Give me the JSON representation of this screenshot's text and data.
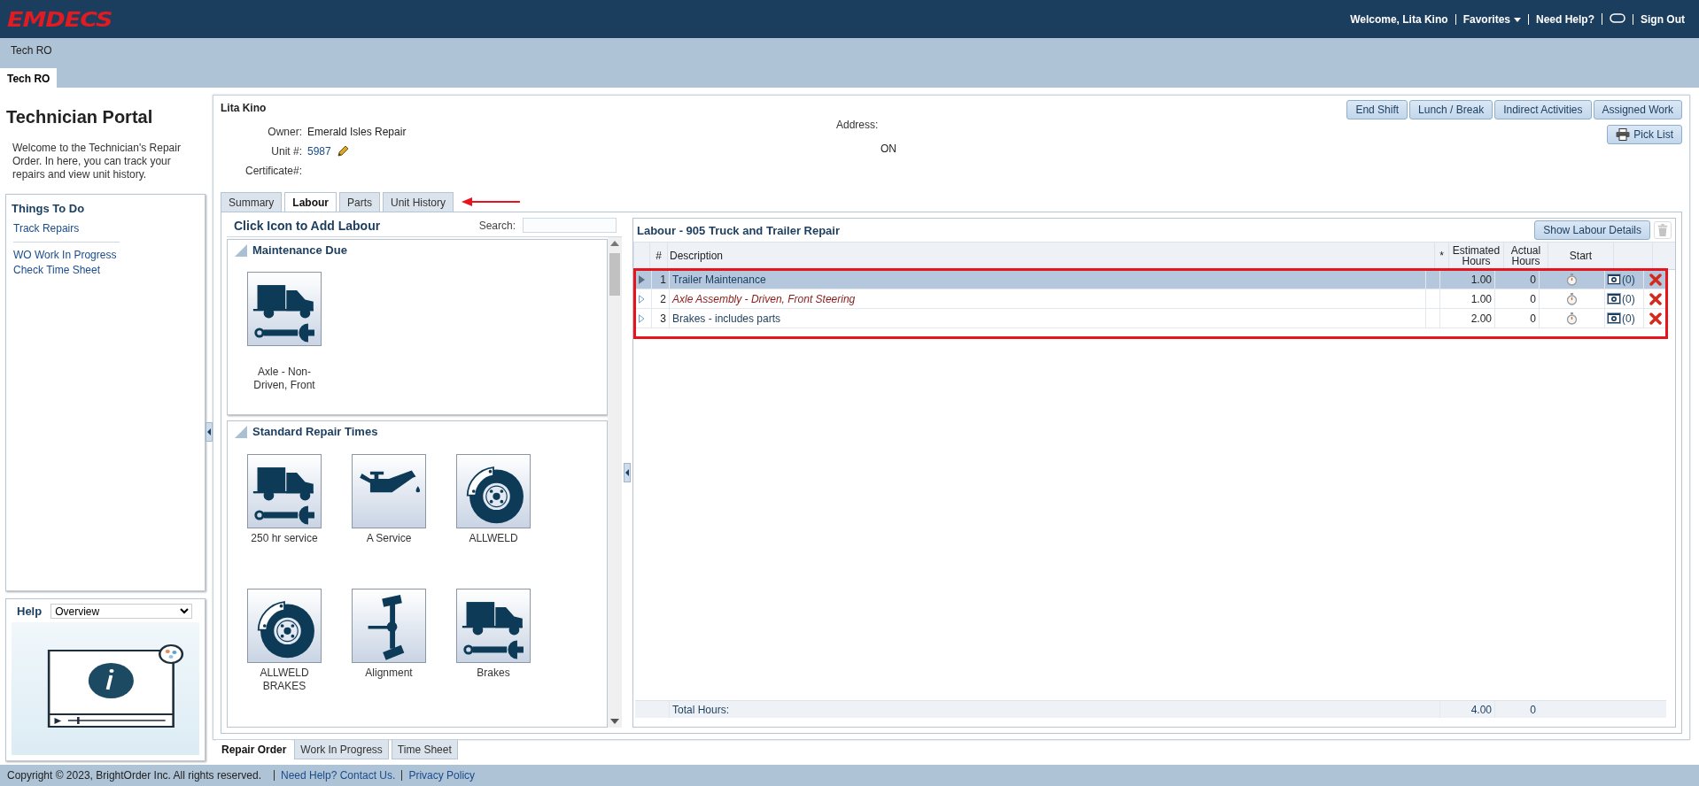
{
  "app": {
    "logo": "EMDECS",
    "welcome": "Welcome, Lita Kino",
    "links": [
      {
        "label": "Favorites",
        "dropdown": true
      },
      {
        "label": "Need Help?",
        "dropdown": false
      }
    ],
    "sign_out": "Sign Out"
  },
  "breadcrumb": "Tech RO",
  "page_tabs": [
    {
      "label": "Tech RO",
      "selected": true
    }
  ],
  "sidebar": {
    "title": "Technician Portal",
    "intro": "Welcome to the Technician's Repair Order. In here, you can track your repairs and view unit history.",
    "things_to_do": {
      "title": "Things To Do",
      "groups": [
        {
          "links": [
            "Track Repairs"
          ]
        },
        {
          "links": [
            "WO Work In Progress",
            "Check Time Sheet"
          ]
        }
      ]
    },
    "help": {
      "title": "Help",
      "topic": "Overview"
    }
  },
  "repair_order": {
    "technician": "Lita Kino",
    "fields": [
      {
        "label": "Owner:",
        "value": "Emerald Isles Repair",
        "kind": "text"
      },
      {
        "label": "Unit #:",
        "value": "5987",
        "kind": "link"
      },
      {
        "label": "Certificate#:"
      }
    ],
    "address": {
      "label": "Address:",
      "value": "ON"
    },
    "actions": [
      "End Shift",
      "Lunch / Break",
      "Indirect Activities",
      "Assigned Work"
    ],
    "pick_list": "Pick List",
    "tabs": [
      {
        "label": "Summary",
        "selected": false
      },
      {
        "label": "Labour",
        "selected": true
      },
      {
        "label": "Parts",
        "selected": false
      },
      {
        "label": "Unit History",
        "selected": false
      }
    ]
  },
  "labour_picker": {
    "title": "Click Icon to Add Labour",
    "search_label": "Search:",
    "sections": [
      {
        "title": "Maintenance Due",
        "expanded": true,
        "tiles": [
          {
            "label": "Axle - Non-Driven, Front",
            "kind": "truck"
          }
        ]
      },
      {
        "title": "Standard Repair Times",
        "expanded": true,
        "tiles": [
          {
            "label": "250 hr service",
            "kind": "truck"
          },
          {
            "label": "A Service",
            "kind": "oil"
          },
          {
            "label": "ALLWELD",
            "kind": "brake"
          },
          {
            "label": "ALLWELD BRAKES",
            "kind": "brake"
          },
          {
            "label": "Alignment",
            "kind": "alignment"
          },
          {
            "label": "Brakes",
            "kind": "truck"
          }
        ]
      }
    ]
  },
  "labour": {
    "title": "Labour - 905 Truck and Trailer Repair",
    "details_button": "Show Labour Details",
    "columns": [
      "#",
      "Description",
      "*",
      "Estimated Hours",
      "Actual Hours",
      "Start"
    ],
    "rows": [
      {
        "number": "1",
        "description": "Trailer Maintenance",
        "estimated": "1.00",
        "actual": "0",
        "attachments": "(0)",
        "selected": true,
        "flagged": false
      },
      {
        "number": "2",
        "description": "Axle Assembly - Driven, Front Steering",
        "estimated": "1.00",
        "actual": "0",
        "attachments": "(0)",
        "selected": false,
        "flagged": true
      },
      {
        "number": "3",
        "description": "Brakes - includes parts",
        "estimated": "2.00",
        "actual": "0",
        "attachments": "(0)",
        "selected": false,
        "flagged": false
      }
    ],
    "total_label": "Total Hours:",
    "total_estimated": "4.00",
    "total_actual": "0"
  },
  "bottom_tabs": [
    {
      "label": "Repair Order",
      "selected": true
    },
    {
      "label": "Work In Progress",
      "selected": false
    },
    {
      "label": "Time Sheet",
      "selected": false
    }
  ],
  "footer": {
    "copyright": "Copyright © 2023, BrightOrder Inc. All rights reserved.",
    "links": [
      "Need Help? Contact Us.",
      "Privacy Policy"
    ]
  }
}
